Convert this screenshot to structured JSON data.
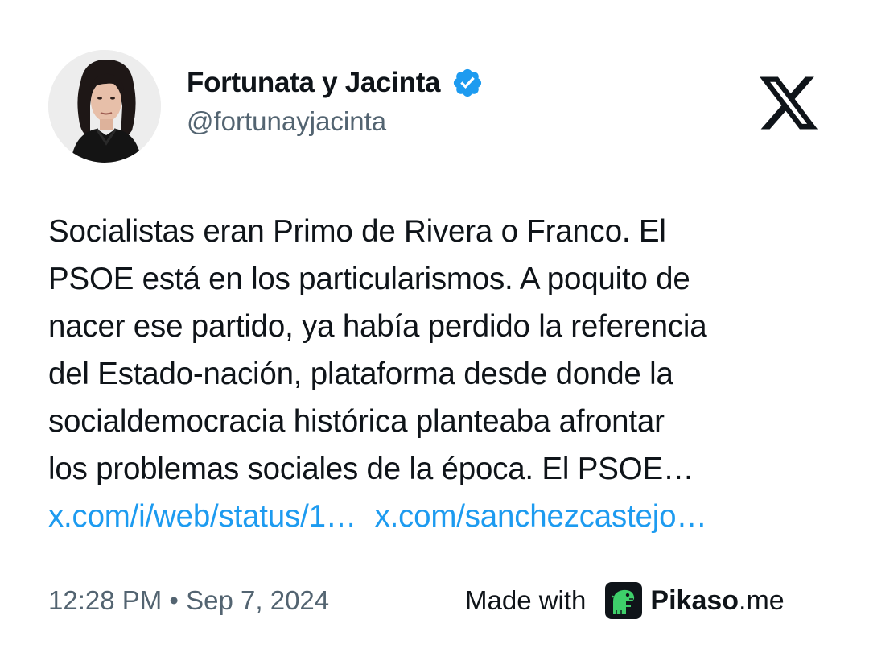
{
  "author": {
    "display_name": "Fortunata y Jacinta",
    "handle": "@fortunayjacinta",
    "verified": true,
    "verified_icon": "verified-badge-icon",
    "verified_color": "#1d9bf0"
  },
  "platform_icon": "x-logo-icon",
  "tweet": {
    "lines": [
      "Socialistas eran Primo de Rivera o Franco. El",
      "PSOE está en los particularismos. A poquito de",
      "nacer ese partido, ya había perdido la referencia",
      "del Estado-nación, plataforma desde donde la",
      "socialdemocracia histórica planteaba afrontar",
      "los problemas sociales de la época. El PSOE…"
    ],
    "links": [
      "x.com/i/web/status/1…",
      "x.com/sanchezcastejo…"
    ],
    "link_color": "#1d9bf0"
  },
  "footer": {
    "timestamp": "12:28 PM • Sep 7, 2024",
    "made_with": "Made with",
    "brand_bold": "Pikaso",
    "brand_suffix": ".me",
    "brand_icon": "pikaso-dino-icon"
  }
}
